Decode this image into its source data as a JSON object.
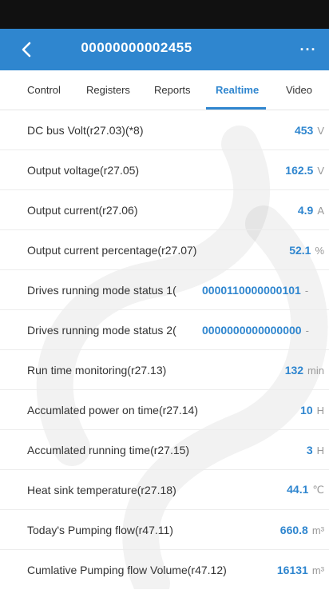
{
  "header": {
    "title": "00000000002455",
    "back_icon": "chevron-left-icon",
    "more_label": "···"
  },
  "tabs": [
    "Control",
    "Registers",
    "Reports",
    "Realtime",
    "Video"
  ],
  "active_tab": "Realtime",
  "rows": [
    {
      "label": "DC bus Volt(r27.03)(*8)",
      "value": "453",
      "unit": "V"
    },
    {
      "label": "Output voltage(r27.05)",
      "value": "162.5",
      "unit": "V"
    },
    {
      "label": "Output current(r27.06)",
      "value": "4.9",
      "unit": "A"
    },
    {
      "label": "Output current percentage(r27.07)",
      "value": "52.1",
      "unit": "%"
    },
    {
      "label": "Drives running mode status 1(",
      "value": "0000110000000101",
      "unit": "-"
    },
    {
      "label": "Drives running mode status 2(",
      "value": "0000000000000000",
      "unit": "-"
    },
    {
      "label": "Run time monitoring(r27.13)",
      "value": "132",
      "unit": "min"
    },
    {
      "label": "Accumlated power on time(r27.14)",
      "value": "10",
      "unit": "H"
    },
    {
      "label": "Accumlated running time(r27.15)",
      "value": "3",
      "unit": "H"
    },
    {
      "label": "Heat sink temperature(r27.18)",
      "value": "44.1",
      "unit": "℃"
    },
    {
      "label": "Today's Pumping flow(r47.11)",
      "value": "660.8",
      "unit": "m³"
    },
    {
      "label": "Cumlative Pumping flow Volume(r47.12)",
      "value": "16131",
      "unit": "m³"
    }
  ],
  "colors": {
    "accent": "#2f86cf",
    "status_bar": "#111111",
    "unit_gray": "#999999"
  }
}
